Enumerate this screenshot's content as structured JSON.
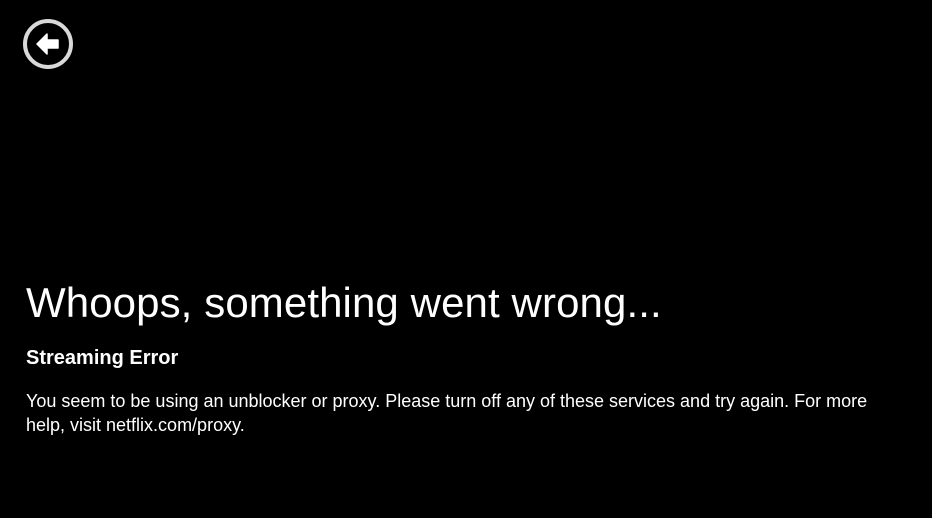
{
  "back_button": {
    "icon": "back-arrow-icon",
    "ring_color": "#d9d9d9",
    "arrow_color": "#ffffff"
  },
  "error": {
    "title": "Whoops, something went wrong...",
    "code": "Streaming Error",
    "message": "You seem to be using an unblocker or proxy. Please turn off any of these services and try again. For more help, visit netflix.com/proxy."
  },
  "colors": {
    "background": "#000000",
    "text": "#ffffff"
  }
}
